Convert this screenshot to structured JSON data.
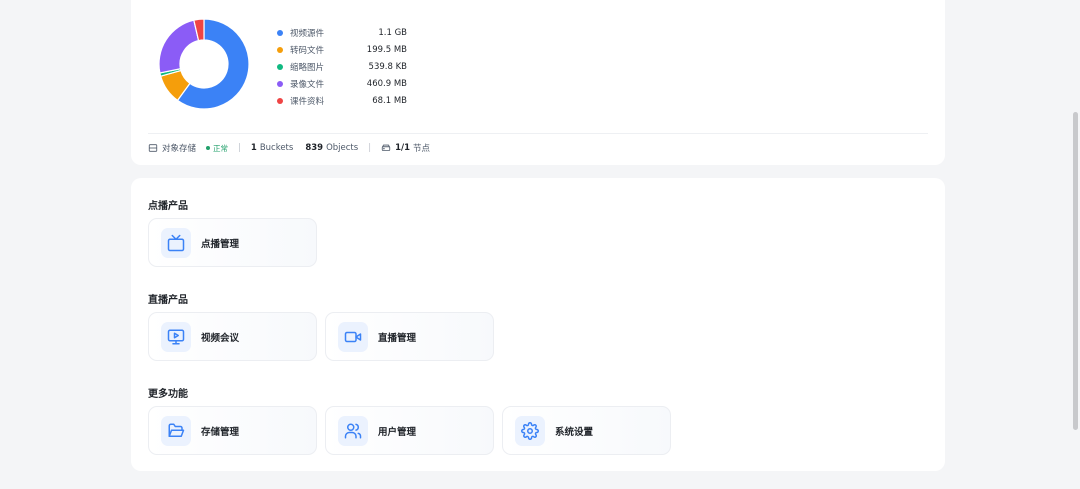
{
  "storage": {
    "legend": [
      {
        "name": "视频源件",
        "size": "1.1 GB",
        "color": "#3b82f6"
      },
      {
        "name": "转码文件",
        "size": "199.5 MB",
        "color": "#f59e0b"
      },
      {
        "name": "缩略图片",
        "size": "539.8 KB",
        "color": "#10b981"
      },
      {
        "name": "录像文件",
        "size": "460.9 MB",
        "color": "#8b5cf6"
      },
      {
        "name": "课件资料",
        "size": "68.1 MB",
        "color": "#ef4444"
      }
    ],
    "status_bar": {
      "label": "对象存储",
      "status": "正常",
      "buckets_count": "1",
      "buckets_label": "Buckets",
      "objects_count": "839",
      "objects_label": "Objects",
      "nodes_count": "1/1",
      "nodes_label": "节点"
    }
  },
  "chart_data": {
    "type": "pie",
    "categories": [
      "视频源件",
      "转码文件",
      "缩略图片",
      "录像文件",
      "课件资料"
    ],
    "values": [
      1126.4,
      199.5,
      0.5271,
      460.9,
      68.1
    ],
    "colors": [
      "#3b82f6",
      "#f59e0b",
      "#10b981",
      "#8b5cf6",
      "#ef4444"
    ],
    "title": "",
    "legend": "right"
  },
  "sections": [
    {
      "title": "点播产品",
      "tiles": [
        {
          "label": "点播管理",
          "icon": "tv-icon"
        }
      ]
    },
    {
      "title": "直播产品",
      "tiles": [
        {
          "label": "视频会议",
          "icon": "monitor-play-icon"
        },
        {
          "label": "直播管理",
          "icon": "video-camera-icon"
        }
      ]
    },
    {
      "title": "更多功能",
      "tiles": [
        {
          "label": "存储管理",
          "icon": "folder-open-icon"
        },
        {
          "label": "用户管理",
          "icon": "users-icon"
        },
        {
          "label": "系统设置",
          "icon": "gear-icon"
        }
      ]
    }
  ]
}
